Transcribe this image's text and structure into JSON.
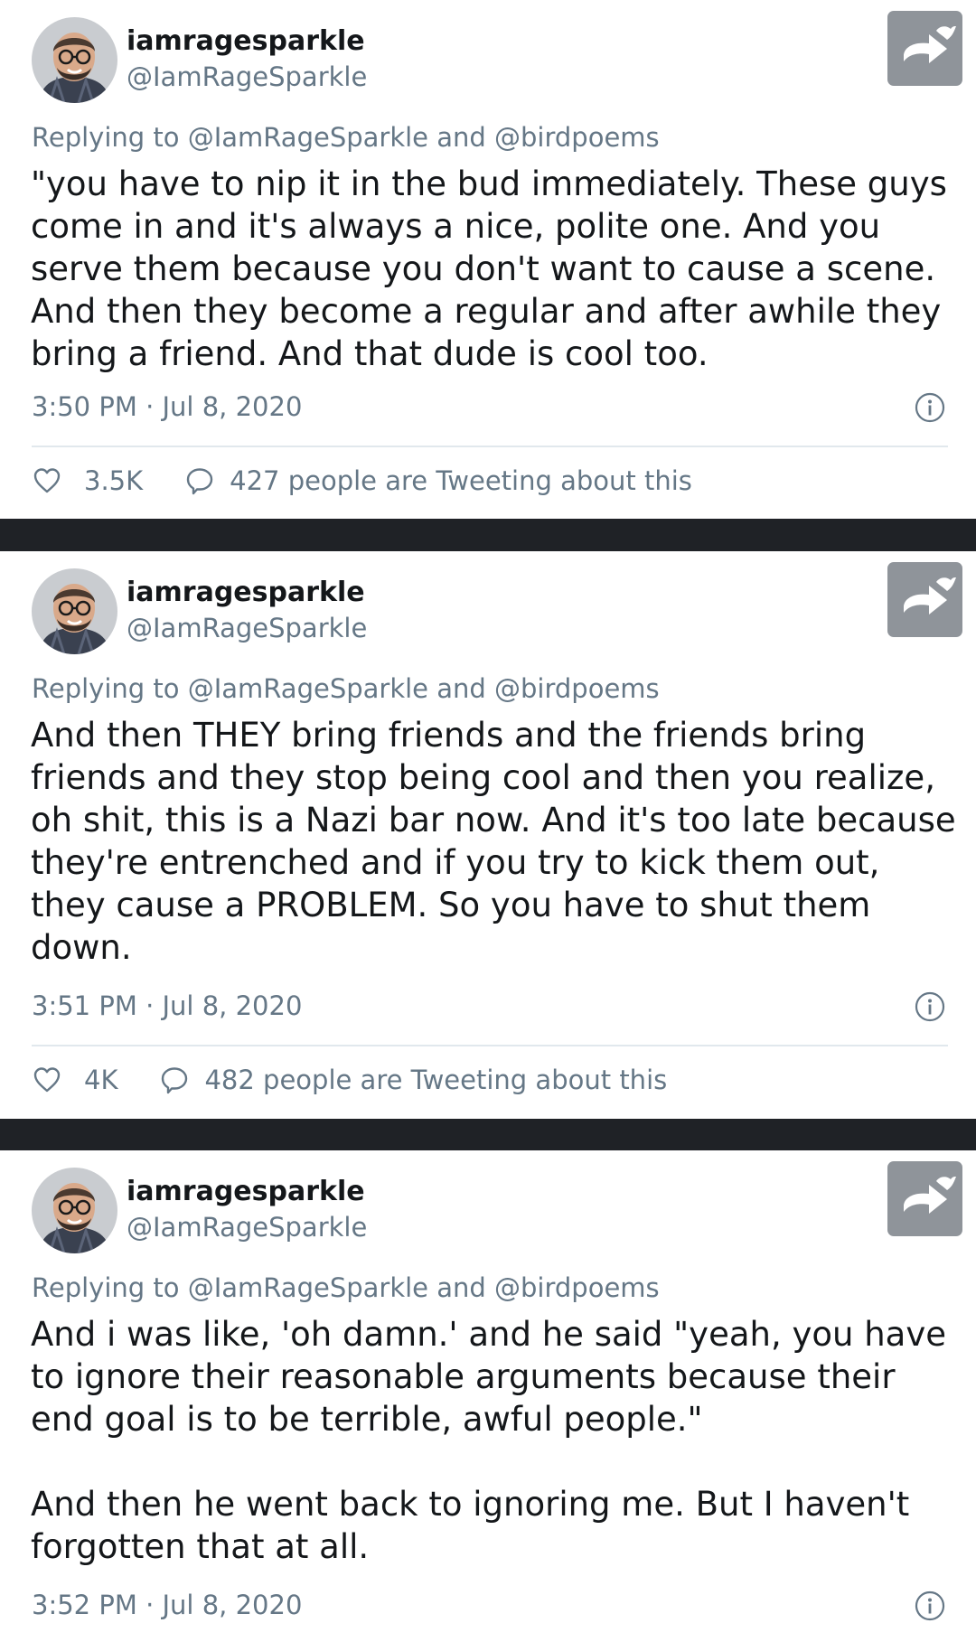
{
  "tweets": [
    {
      "display_name": "iamragesparkle",
      "handle": "@IamRageSparkle",
      "replying_to": "Replying to @IamRageSparkle and @birdpoems",
      "text": [
        "\"you have to nip it in the bud immediately. These guys come in and it's always a nice, polite one. And you serve them because you don't want to cause a scene. And then they become a regular and after awhile they bring a friend. And that dude is cool too."
      ],
      "timestamp": "3:50 PM · Jul 8, 2020",
      "likes": "3.5K",
      "tweeting": "427 people are Tweeting about this"
    },
    {
      "display_name": "iamragesparkle",
      "handle": "@IamRageSparkle",
      "replying_to": "Replying to @IamRageSparkle and @birdpoems",
      "text": [
        "And then THEY bring friends and the friends bring friends and they stop being cool and then you realize, oh shit, this is a Nazi bar now. And it's too late because they're entrenched and if you try to kick them out, they cause a PROBLEM. So you have to shut them down."
      ],
      "timestamp": "3:51 PM · Jul 8, 2020",
      "likes": "4K",
      "tweeting": "482 people are Tweeting about this"
    },
    {
      "display_name": "iamragesparkle",
      "handle": "@IamRageSparkle",
      "replying_to": "Replying to @IamRageSparkle and @birdpoems",
      "text": [
        "And i was like, 'oh damn.' and he said \"yeah, you have to ignore their reasonable arguments because their end goal is to be terrible, awful people.\"",
        "And then he went back to ignoring me. But I haven't forgotten that at all."
      ],
      "timestamp": "3:52 PM · Jul 8, 2020"
    }
  ],
  "icons": {
    "share": "twitter-share-icon",
    "info": "info-icon",
    "like": "heart-icon",
    "reply": "speech-bubble-icon"
  },
  "colors": {
    "separator": "#1f2226",
    "text": "#14171a",
    "secondary": "#657786",
    "share_button": "#8f949a"
  }
}
